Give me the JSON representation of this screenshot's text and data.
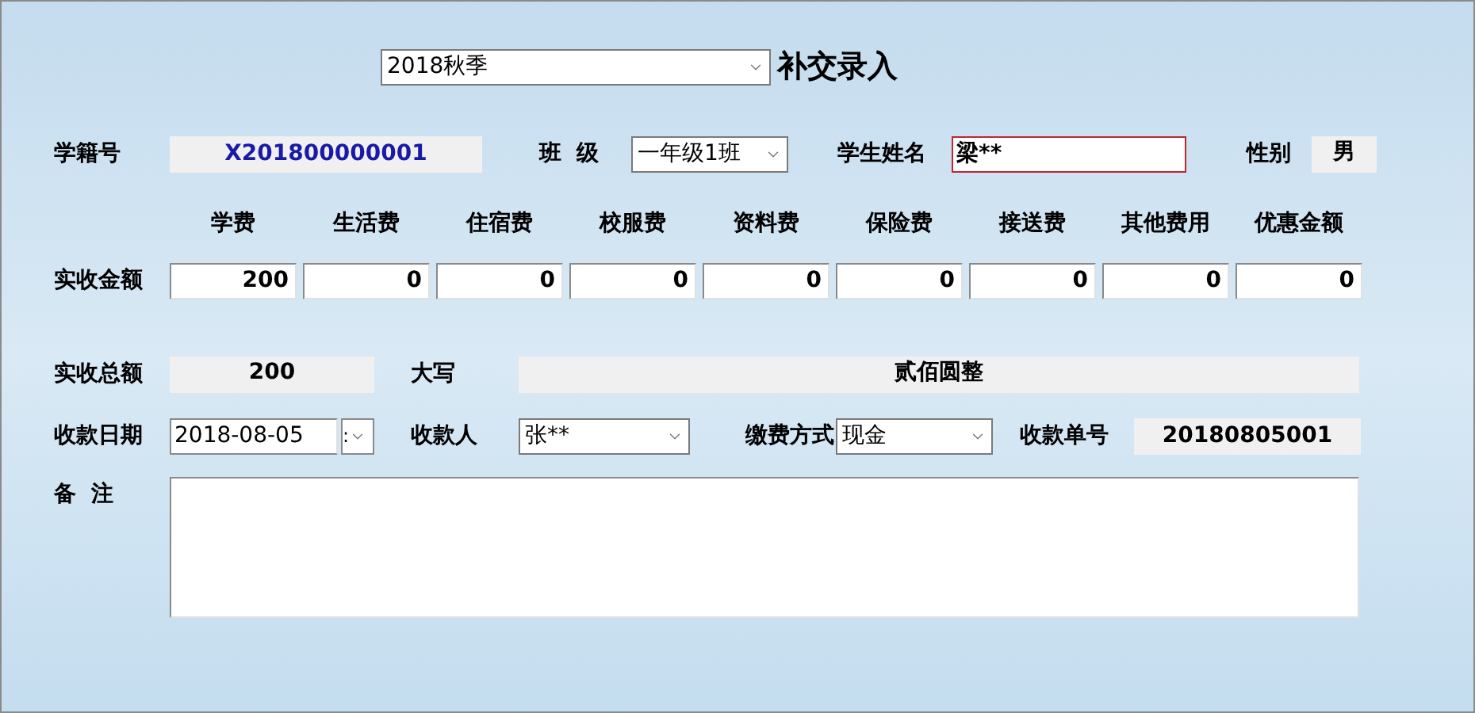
{
  "term_select": {
    "value": "2018秋季"
  },
  "title": "补交录入",
  "student": {
    "id_label": "学籍号",
    "id_value": "X201800000001",
    "class_label": "班  级",
    "class_value": "一年级1班",
    "name_label": "学生姓名",
    "name_value": "梁**",
    "gender_label": "性别",
    "gender_value": "男"
  },
  "fees": {
    "row_label": "实收金额",
    "columns": [
      {
        "header": "学费",
        "value": "200"
      },
      {
        "header": "生活费",
        "value": "0"
      },
      {
        "header": "住宿费",
        "value": "0"
      },
      {
        "header": "校服费",
        "value": "0"
      },
      {
        "header": "资料费",
        "value": "0"
      },
      {
        "header": "保险费",
        "value": "0"
      },
      {
        "header": "接送费",
        "value": "0"
      },
      {
        "header": "其他费用",
        "value": "0"
      },
      {
        "header": "优惠金额",
        "value": "0"
      }
    ]
  },
  "total": {
    "label": "实收总额",
    "value": "200",
    "words_label": "大写",
    "words_value": "贰佰圆整"
  },
  "payment": {
    "date_label": "收款日期",
    "date_value": "2018-08-05",
    "date_spin": ":",
    "payee_label": "收款人",
    "payee_value": "张**",
    "method_label": "缴费方式",
    "method_value": "现金",
    "receipt_label": "收款单号",
    "receipt_value": "20180805001"
  },
  "notes": {
    "label": "备  注"
  }
}
